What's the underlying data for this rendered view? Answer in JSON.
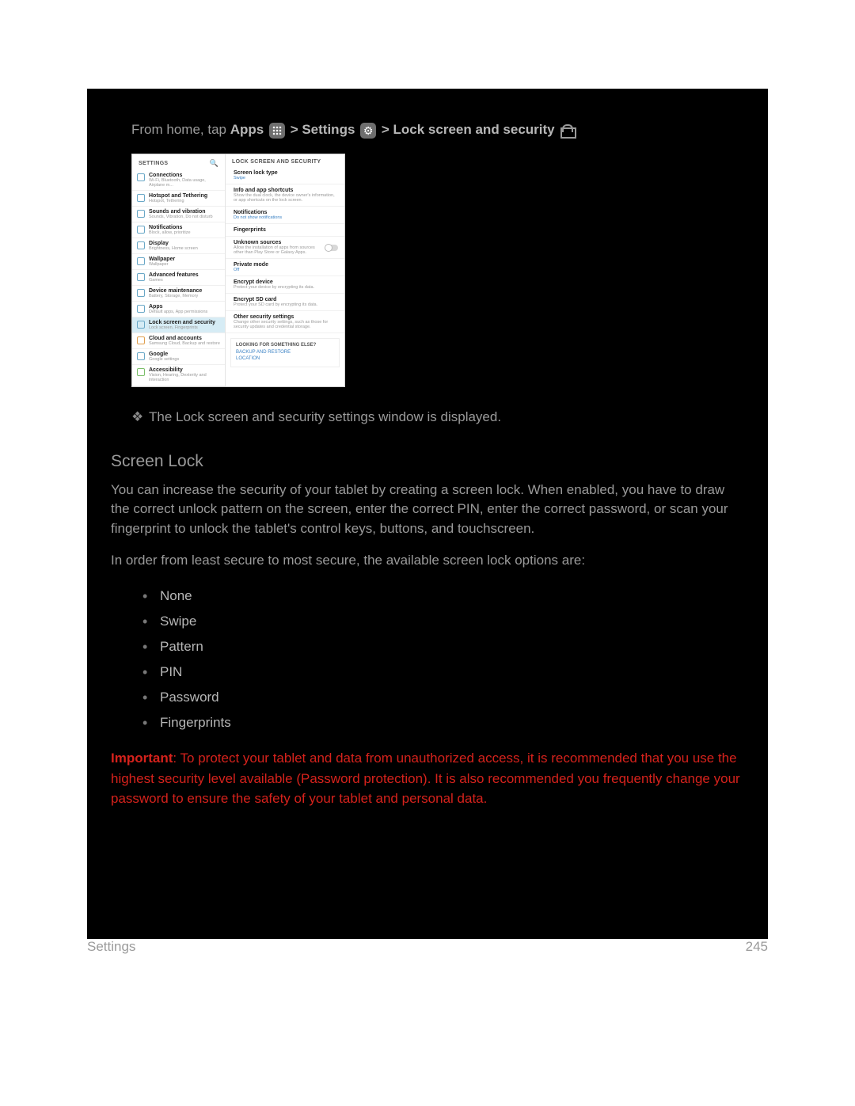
{
  "instruction": {
    "prefix": "From home, tap ",
    "apps": "Apps",
    "sep1": " > ",
    "settings": "Settings",
    "sep2": " > ",
    "lockscreen": "Lock screen and security"
  },
  "shot": {
    "left_header": "SETTINGS",
    "right_header": "LOCK SCREEN AND SECURITY",
    "left_items": [
      {
        "t": "Connections",
        "s": "Wi-Fi, Bluetooth, Data usage, Airplane m..."
      },
      {
        "t": "Hotspot and Tethering",
        "s": "Hotspot, Tethering"
      },
      {
        "t": "Sounds and vibration",
        "s": "Sounds, Vibration, Do not disturb"
      },
      {
        "t": "Notifications",
        "s": "Block, allow, prioritize"
      },
      {
        "t": "Display",
        "s": "Brightness, Home screen"
      },
      {
        "t": "Wallpaper",
        "s": "Wallpaper"
      },
      {
        "t": "Advanced features",
        "s": "Games"
      },
      {
        "t": "Device maintenance",
        "s": "Battery, Storage, Memory"
      },
      {
        "t": "Apps",
        "s": "Default apps, App permissions"
      },
      {
        "t": "Lock screen and security",
        "s": "Lock screen, Fingerprints"
      },
      {
        "t": "Cloud and accounts",
        "s": "Samsung Cloud, Backup and restore"
      },
      {
        "t": "Google",
        "s": "Google settings"
      },
      {
        "t": "Accessibility",
        "s": "Vision, Hearing, Dexterity and interaction"
      }
    ],
    "right_items": [
      {
        "t": "Screen lock type",
        "s": "Swipe",
        "blue": true
      },
      {
        "t": "Info and app shortcuts",
        "s": "Show the dual clock, the device owner's information, or app shortcuts on the lock screen."
      },
      {
        "t": "Notifications",
        "s": "Do not show notifications",
        "blue": true
      },
      {
        "t": "Fingerprints",
        "s": ""
      },
      {
        "t": "Unknown sources",
        "s": "Allow the installation of apps from sources other than Play Store or Galaxy Apps.",
        "toggle": true
      },
      {
        "t": "Private mode",
        "s": "Off",
        "blue": true
      },
      {
        "t": "Encrypt device",
        "s": "Protect your device by encrypting its data."
      },
      {
        "t": "Encrypt SD card",
        "s": "Protect your SD card by encrypting its data."
      },
      {
        "t": "Other security settings",
        "s": "Change other security settings, such as those for security updates and credential storage."
      }
    ],
    "looking": {
      "hd": "LOOKING FOR SOMETHING ELSE?",
      "l1": "BACKUP AND RESTORE",
      "l2": "LOCATION"
    }
  },
  "result": "The Lock screen and security settings window is displayed.",
  "section_heading": "Screen Lock",
  "para1": "You can increase the security of your tablet by creating a screen lock. When enabled, you have to draw the correct unlock pattern on the screen, enter the correct PIN, enter the correct password, or scan your fingerprint to unlock the tablet's control keys, buttons, and touchscreen.",
  "para2": "In order from least secure to most secure, the available screen lock options are:",
  "options": [
    "None",
    "Swipe",
    "Pattern",
    "PIN",
    "Password",
    "Fingerprints"
  ],
  "important_lead": "Important",
  "important_body": ": To protect your tablet and data from unauthorized access, it is recommended that you use the highest security level available (Password protection). It is also recommended you frequently change your password to ensure the safety of your tablet and personal data.",
  "footer_left": "Settings",
  "footer_right": "245"
}
